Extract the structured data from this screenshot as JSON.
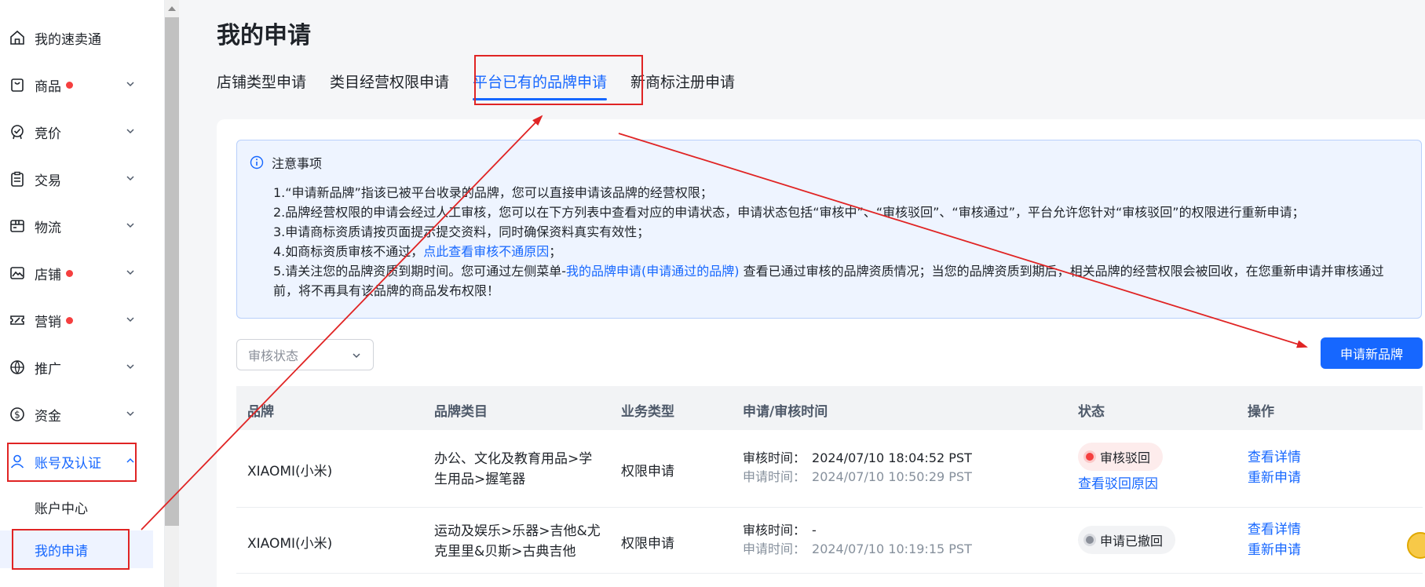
{
  "sidebar": {
    "items": [
      {
        "label": "我的速卖通",
        "icon": "home-icon",
        "dot": false,
        "chevron": false
      },
      {
        "label": "商品",
        "icon": "bag-icon",
        "dot": true,
        "chevron": true
      },
      {
        "label": "竞价",
        "icon": "badge-check-icon",
        "dot": false,
        "chevron": true
      },
      {
        "label": "交易",
        "icon": "clipboard-icon",
        "dot": false,
        "chevron": true
      },
      {
        "label": "物流",
        "icon": "truck-icon",
        "dot": false,
        "chevron": true
      },
      {
        "label": "店铺",
        "icon": "store-icon",
        "dot": true,
        "chevron": true
      },
      {
        "label": "营销",
        "icon": "ticket-icon",
        "dot": true,
        "chevron": true
      },
      {
        "label": "推广",
        "icon": "globe-ad-icon",
        "dot": false,
        "chevron": true
      },
      {
        "label": "资金",
        "icon": "dollar-icon",
        "dot": false,
        "chevron": true
      },
      {
        "label": "账号及认证",
        "icon": "user-icon",
        "dot": false,
        "chevron": true
      }
    ],
    "sub_items": [
      {
        "label": "账户中心"
      },
      {
        "label": "我的申请"
      }
    ]
  },
  "page": {
    "title": "我的申请",
    "tabs": [
      {
        "label": "店铺类型申请"
      },
      {
        "label": "类目经营权限申请"
      },
      {
        "label": "平台已有的品牌申请"
      },
      {
        "label": "新商标注册申请"
      }
    ]
  },
  "notice": {
    "title": "注意事项",
    "line1": "1.“申请新品牌”指该已被平台收录的品牌，您可以直接申请该品牌的经营权限；",
    "line2": "2.品牌经营权限的申请会经过人工审核，您可以在下方列表中查看对应的申请状态，申请状态包括“审核中”、“审核驳回”、“审核通过”，平台允许您针对“审核驳回”的权限进行重新申请；",
    "line3": "3.申请商标资质请按页面提示提交资料，同时确保资料真实有效性；",
    "line4_prefix": "4.如商标资质审核不通过，",
    "line4_link": "点此查看审核不通原因",
    "line4_suffix": "；",
    "line5_prefix": "5.请关注您的品牌资质到期时间。您可通过左侧菜单-",
    "line5_link": "我的品牌申请(申请通过的品牌)",
    "line5_suffix": " 查看已通过审核的品牌资质情况；当您的品牌资质到期后，相关品牌的经营权限会被回收，在您重新申请并审核通过前，将不再具有该品牌的商品发布权限！"
  },
  "filter": {
    "status_placeholder": "审核状态"
  },
  "apply_button": "申请新品牌",
  "table": {
    "headers": {
      "brand": "品牌",
      "category": "品牌类目",
      "biz_type": "业务类型",
      "time": "申请/审核时间",
      "status": "状态",
      "action": "操作"
    },
    "rows": [
      {
        "brand": "XIAOMI(小米)",
        "category_l1": "办公、文化及教育用品>学",
        "category_l2": "生用品>握笔器",
        "biz_type": "权限申请",
        "review_label": "审核时间：",
        "review_time": "2024/07/10 18:04:52 PST",
        "apply_label": "申请时间：",
        "apply_time": "2024/07/10 10:50:29 PST",
        "status": "审核驳回",
        "status_link": "查看驳回原因",
        "action1": "查看详情",
        "action2": "重新申请"
      },
      {
        "brand": "XIAOMI(小米)",
        "category_l1": "运动及娱乐>乐器>吉他&尤",
        "category_l2": "克里里&贝斯>古典吉他",
        "biz_type": "权限申请",
        "review_label": "审核时间：",
        "review_time": "-",
        "apply_label": "申请时间：",
        "apply_time": "2024/07/10 10:19:15 PST",
        "status": "申请已撤回",
        "status_link": "",
        "action1": "查看详情",
        "action2": "重新申请"
      }
    ]
  },
  "colors": {
    "accent": "#1667ff",
    "annotation": "#e02424",
    "danger_dot": "#f53f3f"
  }
}
